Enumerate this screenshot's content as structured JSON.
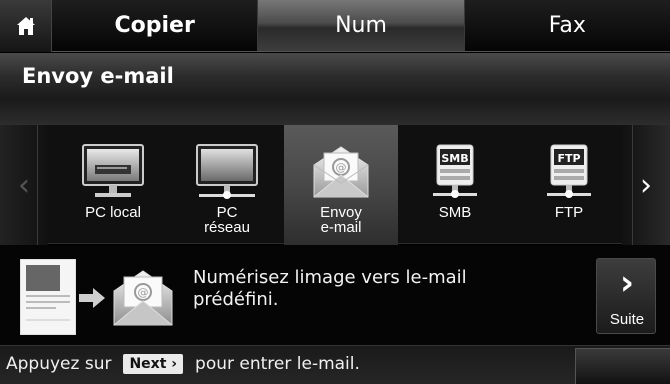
{
  "topbar": {
    "home_icon": "home-icon",
    "tabs": [
      {
        "label": "Copier",
        "active": false
      },
      {
        "label": "Num",
        "active": true
      },
      {
        "label": "Fax",
        "active": false
      }
    ]
  },
  "title": "Envoy e-mail",
  "carousel": {
    "left_arrow": "‹",
    "right_arrow": "›",
    "items": [
      {
        "label": "PC local",
        "label2": "",
        "icon": "pc-local-icon",
        "active": false
      },
      {
        "label": "PC",
        "label2": "réseau",
        "icon": "pc-network-icon",
        "active": false
      },
      {
        "label": "Envoy",
        "label2": "e-mail",
        "icon": "email-icon",
        "active": true
      },
      {
        "label": "SMB",
        "label2": "",
        "icon": "smb-icon",
        "badge": "SMB",
        "active": false
      },
      {
        "label": "FTP",
        "label2": "",
        "icon": "ftp-icon",
        "badge": "FTP",
        "active": false
      }
    ]
  },
  "info": {
    "text_line1": "Numérisez limage vers le-mail",
    "text_line2": "prédéfini.",
    "document_icon": "document-icon",
    "arrow_icon": "arrow-right-icon",
    "mail_icon": "email-icon"
  },
  "next_button": {
    "chevron": "›",
    "label": "Suite"
  },
  "hint": {
    "before": "Appuyez sur",
    "key": "Next ›",
    "after": "pour entrer le-mail."
  },
  "colors": {
    "background": "#000000",
    "active_tab": "#4c4c4c",
    "text": "#ffffff"
  }
}
